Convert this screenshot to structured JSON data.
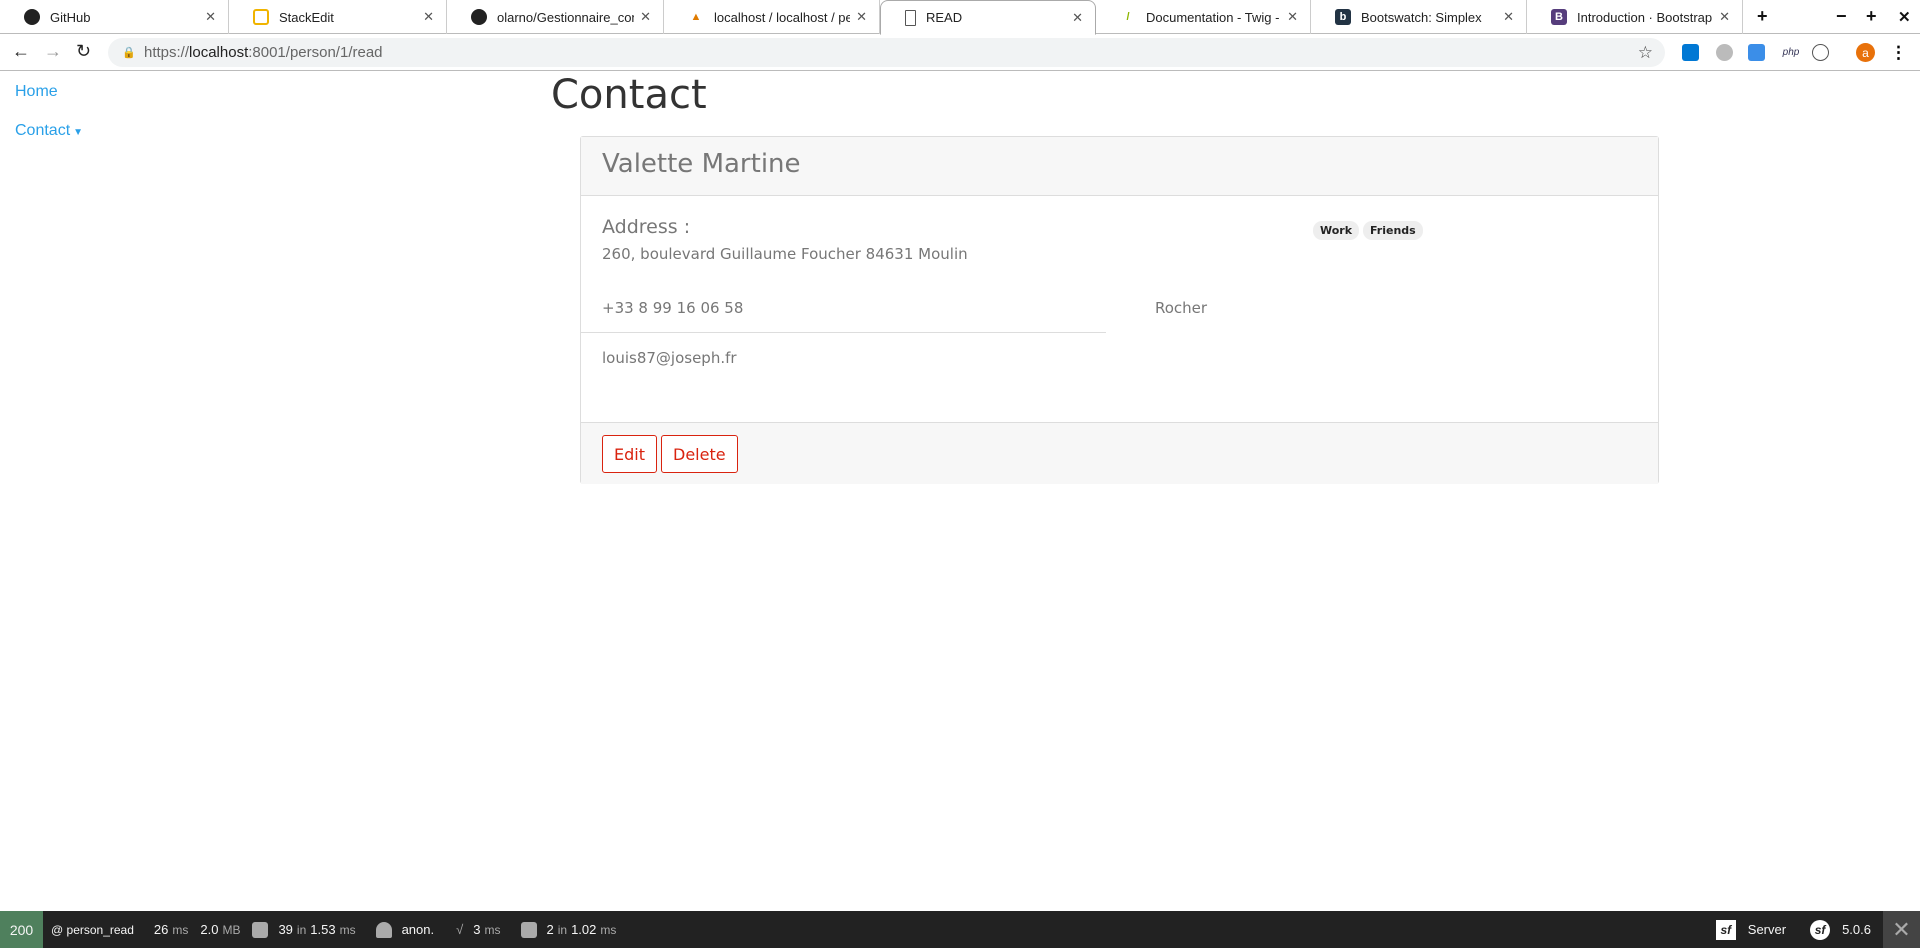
{
  "browser": {
    "tabs": [
      {
        "title": "GitHub",
        "icon": "github-icon"
      },
      {
        "title": "StackEdit",
        "icon": "stackedit-icon"
      },
      {
        "title": "olarno/Gestionnaire_contac",
        "icon": "github-icon"
      },
      {
        "title": "localhost / localhost / perso",
        "icon": "phpmyadmin-icon"
      },
      {
        "title": "READ",
        "icon": "page-icon"
      },
      {
        "title": "Documentation - Twig - The",
        "icon": "twig-icon"
      },
      {
        "title": "Bootswatch: Simplex",
        "icon": "bootswatch-icon"
      },
      {
        "title": "Introduction · Bootstrap",
        "icon": "bootstrap-icon"
      }
    ],
    "url_scheme": "https://",
    "url_host": "localhost",
    "url_rest": ":8001/person/1/read",
    "avatar_letter": "a",
    "ext_php": "php"
  },
  "nav": {
    "home": "Home",
    "contact": "Contact"
  },
  "page": {
    "title": "Contact"
  },
  "contact": {
    "name": "Valette Martine",
    "address_label": "Address :",
    "address": "260, boulevard Guillaume Foucher 84631 Moulin",
    "tags": [
      "Work",
      "Friends"
    ],
    "phone": "+33 8 99 16 06 58",
    "city": "Rocher",
    "email": "louis87@joseph.fr",
    "edit": "Edit",
    "delete": "Delete"
  },
  "toolbar": {
    "status": "200",
    "route": "@ person_read",
    "time": "26",
    "time_unit": "ms",
    "memory": "2.0",
    "memory_unit": "MB",
    "events": "39",
    "events_in": "in",
    "events_time": "1.53",
    "events_unit": "ms",
    "user": "anon.",
    "twig": "3",
    "twig_unit": "ms",
    "db": "2",
    "db_in": "in",
    "db_time": "1.02",
    "db_unit": "ms",
    "server": "Server",
    "version": "5.0.6"
  },
  "colors": {
    "accent": "#d9230f",
    "link": "#2aa0e8",
    "status_ok": "#4f805d"
  }
}
